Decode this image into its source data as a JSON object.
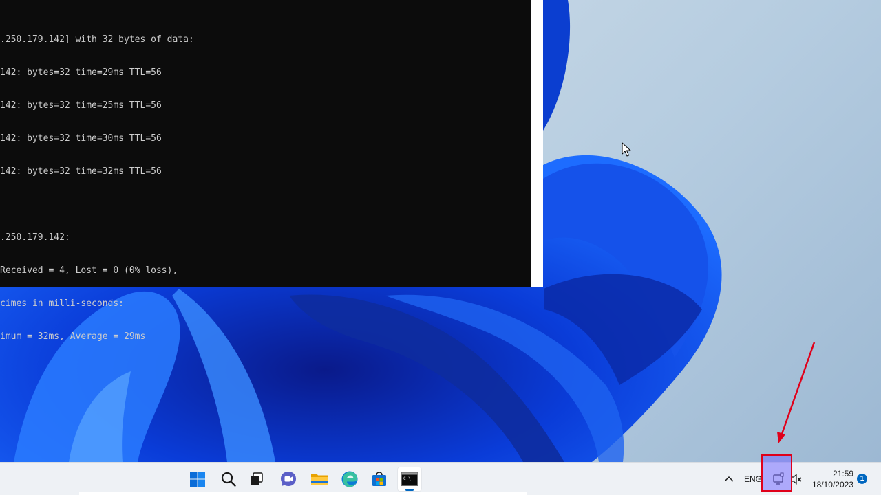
{
  "terminal": {
    "lines": [
      ".250.179.142] with 32 bytes of data:",
      "142: bytes=32 time=29ms TTL=56",
      "142: bytes=32 time=25ms TTL=56",
      "142: bytes=32 time=30ms TTL=56",
      "142: bytes=32 time=32ms TTL=56",
      "",
      ".250.179.142:",
      "Received = 4, Lost = 0 (0% loss),",
      "cimes in milli-seconds:",
      "imum = 32ms, Average = 29ms"
    ]
  },
  "taskbar": {
    "apps": [
      {
        "name": "start-button",
        "icon": "windows-logo-icon"
      },
      {
        "name": "search-button",
        "icon": "search-icon"
      },
      {
        "name": "task-view-button",
        "icon": "task-view-icon"
      },
      {
        "name": "teams-chat-button",
        "icon": "chat-icon"
      },
      {
        "name": "file-explorer-button",
        "icon": "folder-icon"
      },
      {
        "name": "edge-button",
        "icon": "edge-icon"
      },
      {
        "name": "store-button",
        "icon": "store-icon"
      },
      {
        "name": "terminal-button",
        "icon": "terminal-icon"
      }
    ],
    "tray": {
      "language": "ENG",
      "time": "21:59",
      "date": "18/10/2023",
      "notification_count": "1"
    }
  },
  "colors": {
    "accent": "#0067c0",
    "annotation_red": "#e0001a"
  }
}
